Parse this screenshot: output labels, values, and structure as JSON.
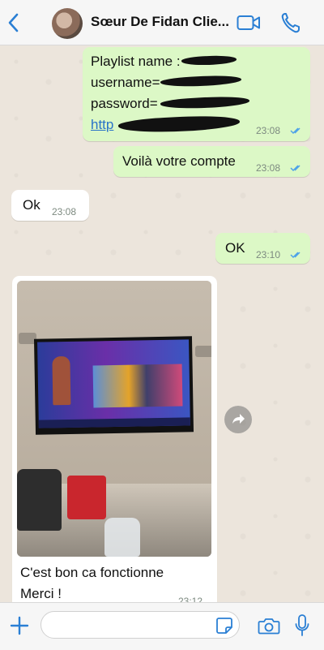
{
  "header": {
    "contact_name": "Sœur De Fidan Clie...",
    "icons": [
      "back-chevron-icon",
      "video-call-icon",
      "phone-icon"
    ]
  },
  "messages": [
    {
      "direction": "outgoing",
      "lines": [
        "Playlist name : ",
        "username=",
        "password=",
        "http"
      ],
      "time": "23:08",
      "status": "read"
    },
    {
      "direction": "outgoing",
      "text": "Voilà votre compte",
      "time": "23:08",
      "status": "read"
    },
    {
      "direction": "incoming",
      "text": "Ok",
      "time": "23:08"
    },
    {
      "direction": "outgoing",
      "text": "OK",
      "time": "23:10",
      "status": "read"
    },
    {
      "direction": "incoming",
      "type": "photo",
      "caption_lines": [
        "C'est bon ca fonctionne",
        "Merci !"
      ],
      "time": "23:12"
    }
  ],
  "composer": {
    "placeholder": "",
    "icons": [
      "plus-icon",
      "sticker-icon",
      "camera-icon",
      "microphone-icon"
    ]
  },
  "colors": {
    "outgoing_bubble": "#dcf8c6",
    "incoming_bubble": "#ffffff",
    "accent": "#2a7fd4",
    "read_ticks": "#4fa3e8"
  }
}
